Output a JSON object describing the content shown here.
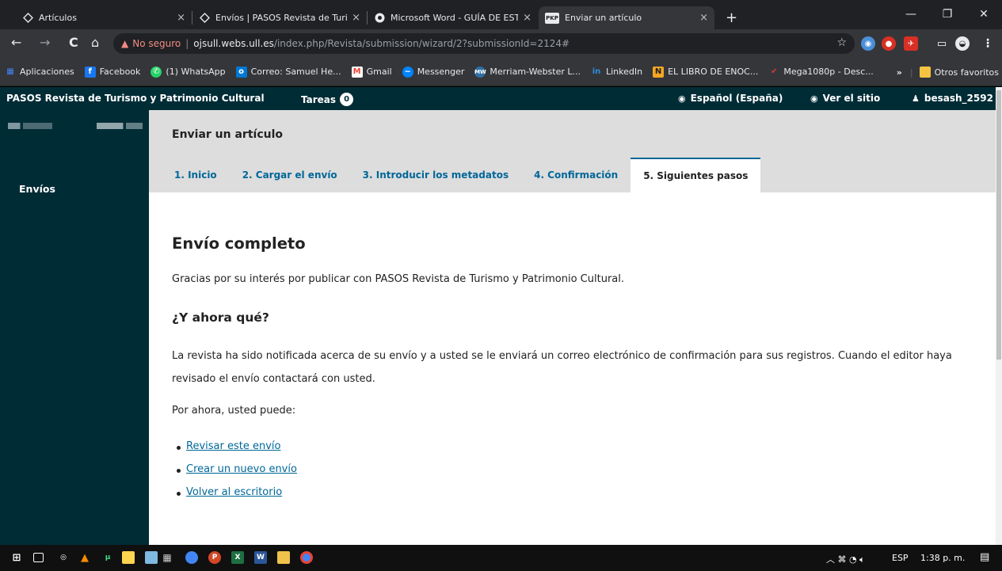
{
  "browser": {
    "tabs": [
      {
        "title": "Artículos",
        "icon": "ojs-diamond-icon"
      },
      {
        "title": "Envíos | PASOS Revista de Turism",
        "icon": "ojs-diamond-icon"
      },
      {
        "title": "Microsoft Word - GUÍA DE ESTILO",
        "icon": "chrome-icon"
      },
      {
        "title": "Enviar un artículo",
        "icon": "pkp-icon"
      }
    ],
    "new_tab": "+",
    "security_warning": "No seguro",
    "url_host": "ojsull.webs.ull.es",
    "url_path": "/index.php/Revista/submission/wizard/2?submissionId=2124#",
    "bookmarks": [
      {
        "label": "Aplicaciones",
        "icon": "apps-grid-icon",
        "color": "#4285f4"
      },
      {
        "label": "Facebook",
        "icon": "facebook-icon",
        "color": "#1877f2"
      },
      {
        "label": "(1) WhatsApp",
        "icon": "whatsapp-icon",
        "color": "#25d366"
      },
      {
        "label": "Correo: Samuel He...",
        "icon": "outlook-icon",
        "color": "#0078d4"
      },
      {
        "label": "Gmail",
        "icon": "gmail-icon",
        "color": "#ea4335"
      },
      {
        "label": "Messenger",
        "icon": "messenger-icon",
        "color": "#0084ff"
      },
      {
        "label": "Merriam-Webster L...",
        "icon": "merriam-webster-icon",
        "color": "#2f6fa3"
      },
      {
        "label": "LinkedIn",
        "icon": "linkedin-icon",
        "color": "#0a66c2"
      },
      {
        "label": "EL LIBRO DE ENOC...",
        "icon": "blogger-icon",
        "color": "#f5a623"
      },
      {
        "label": "Mega1080p - Desc...",
        "icon": "mega-icon",
        "color": "#d93a3a"
      }
    ],
    "more_bookmarks": "»",
    "other_favorites": "Otros favoritos"
  },
  "ojs": {
    "site_name": "PASOS Revista de Turismo y Patrimonio Cultural",
    "tasks_label": "Tareas",
    "tasks_count": "0",
    "language": "Español (España)",
    "view_site": "Ver el sitio",
    "username": "besash_2592",
    "sidebar_nav": "Envíos",
    "page_title": "Enviar un artículo",
    "wizard_tabs": [
      "1. Inicio",
      "2. Cargar el envío",
      "3. Introducir los metadatos",
      "4. Confirmación",
      "5. Siguientes pasos"
    ],
    "active_tab_index": 4,
    "heading": "Envío completo",
    "thanks": "Gracias por su interés por publicar con PASOS Revista de Turismo y Patrimonio Cultural.",
    "subheading": "¿Y ahora qué?",
    "notification": "La revista ha sido notificada acerca de su envío y a usted se le enviará un correo electrónico de confirmación para sus registros. Cuando el editor haya revisado el envío contactará con usted.",
    "for_now": "Por ahora, usted puede:",
    "links": [
      "Revisar este envío",
      "Crear un nuevo envío",
      "Volver al escritorio"
    ]
  },
  "taskbar": {
    "language": "ESP",
    "time": "1:38 p. m."
  },
  "colors": {
    "ojs_dark": "#002c36",
    "ojs_link": "#006798",
    "chrome_dark": "#202124",
    "chrome_toolbar": "#35363a"
  }
}
